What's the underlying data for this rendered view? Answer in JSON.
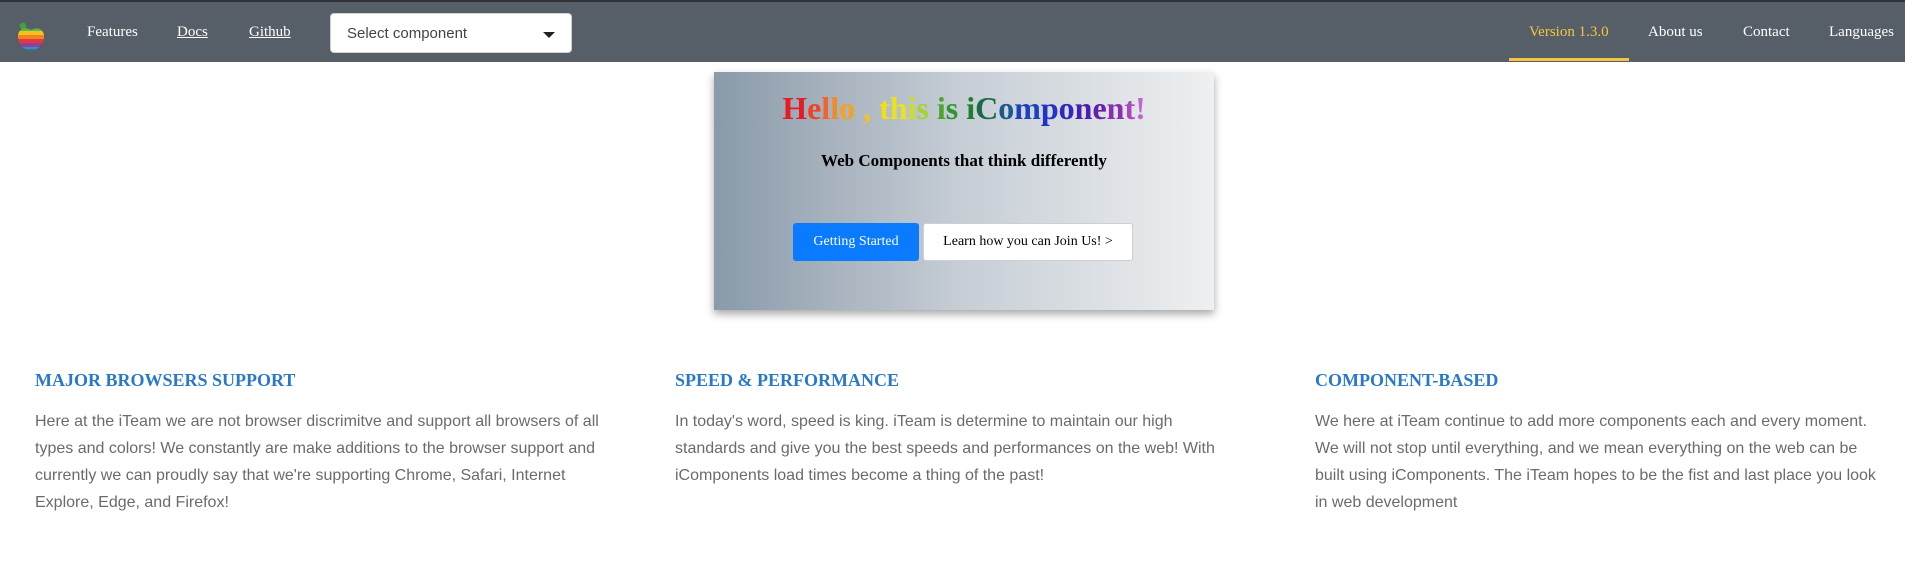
{
  "nav": {
    "logo": "apple-logo-icon",
    "features": "Features",
    "docs": "Docs",
    "github": "Github",
    "select_placeholder": "Select component",
    "version": "Version 1.3.0",
    "about": "About us",
    "contact": "Contact",
    "languages": "Languages",
    "accent_color": "#f5c542",
    "bg_color": "#565e67"
  },
  "hero": {
    "title_parts": [
      {
        "text": "H",
        "color": "#e51c23"
      },
      {
        "text": "e",
        "color": "#ef4423"
      },
      {
        "text": "l",
        "color": "#f1642b"
      },
      {
        "text": "l",
        "color": "#f48a23"
      },
      {
        "text": "o",
        "color": "#f7a11c"
      },
      {
        "text": " , ",
        "color": "#f9c21a"
      },
      {
        "text": "t",
        "color": "#f4de14"
      },
      {
        "text": "h",
        "color": "#e9e31c"
      },
      {
        "text": "i",
        "color": "#cbe022"
      },
      {
        "text": "s",
        "color": "#a3d42b"
      },
      {
        "text": " ",
        "color": "#000000"
      },
      {
        "text": "i",
        "color": "#4aa52b"
      },
      {
        "text": "s",
        "color": "#2d9631"
      },
      {
        "text": " ",
        "color": "#000000"
      },
      {
        "text": "i",
        "color": "#1b7f2e"
      },
      {
        "text": "C",
        "color": "#1a6b47"
      },
      {
        "text": "o",
        "color": "#1a5a8c"
      },
      {
        "text": "m",
        "color": "#1c43b9"
      },
      {
        "text": "p",
        "color": "#2231c8"
      },
      {
        "text": "o",
        "color": "#3226bf"
      },
      {
        "text": "n",
        "color": "#4a1fb0"
      },
      {
        "text": "e",
        "color": "#6521a6"
      },
      {
        "text": "n",
        "color": "#8a2fb0"
      },
      {
        "text": "t",
        "color": "#a946c0"
      },
      {
        "text": "!",
        "color": "#c564cf"
      }
    ],
    "subtitle": "Web Components that think differently",
    "primary_button": "Getting Started",
    "secondary_button": "Learn how you can Join Us! >",
    "primary_color": "#0a7bff"
  },
  "features": [
    {
      "title": "MAJOR BROWSERS SUPPORT",
      "text": "Here at the iTeam we are not browser discrimitve and support all browsers of all types and colors! We constantly are make additions to the browser support and currently we can proudly say that we're supporting Chrome, Safari, Internet Explore, Edge, and Firefox!"
    },
    {
      "title": "SPEED & PERFORMANCE",
      "text": "In today's word, speed is king. iTeam is determine to maintain our high standards and give you the best speeds and performances on the web! With iComponents load times become a thing of the past!"
    },
    {
      "title": "COMPONENT-BASED",
      "text": "We here at iTeam continue to add more components each and every moment. We will not stop until everything, and we mean everything on the web can be built using iComponents. The iTeam hopes to be the fist and last place you look in web development"
    }
  ],
  "heading_color": "#2a78c9"
}
